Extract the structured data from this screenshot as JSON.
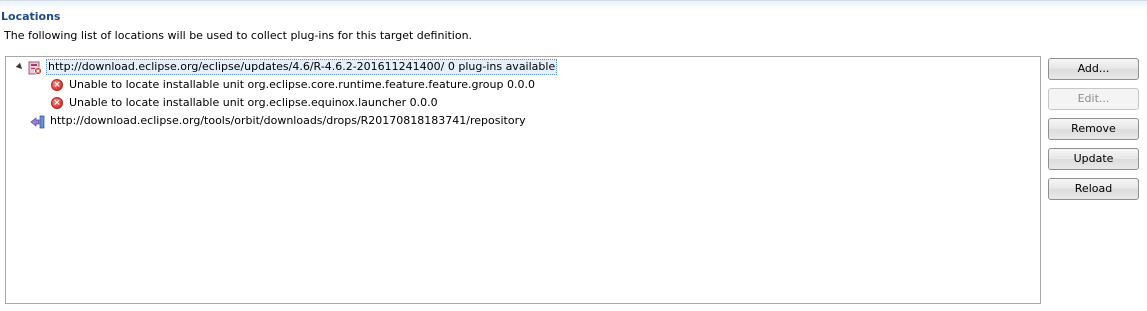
{
  "section": {
    "title": "Locations",
    "description": "The following list of locations will be used to collect plug-ins for this target definition."
  },
  "tree": {
    "items": [
      {
        "label": "http://download.eclipse.org/eclipse/updates/4.6/R-4.6.2-201611241400/ 0 plug-ins available",
        "icon": "update-site-error-icon",
        "expanded": true,
        "selected": true,
        "children": [
          {
            "label": "Unable to locate installable unit org.eclipse.core.runtime.feature.feature.group 0.0.0",
            "icon": "error-icon"
          },
          {
            "label": "Unable to locate installable unit org.eclipse.equinox.launcher 0.0.0",
            "icon": "error-icon"
          }
        ]
      },
      {
        "label": "http://download.eclipse.org/tools/orbit/downloads/drops/R20170818183741/repository",
        "icon": "update-site-icon",
        "expanded": false,
        "selected": false,
        "children": []
      }
    ]
  },
  "buttons": {
    "add": "Add...",
    "edit": "Edit...",
    "remove": "Remove",
    "update": "Update",
    "reload": "Reload"
  },
  "colors": {
    "title": "#1f4a8a",
    "error": "#d7362c",
    "selection_border": "#5d8fd4"
  }
}
